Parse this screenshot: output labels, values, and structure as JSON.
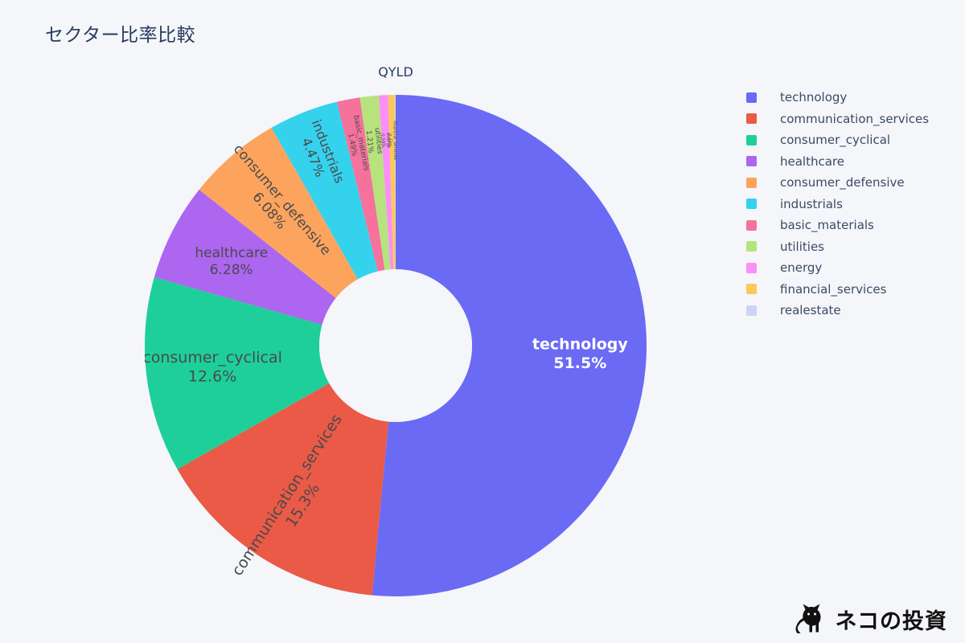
{
  "title": "セクター比率比較",
  "watermark": {
    "text": "ネコの投資",
    "icon": "cat-silhouette-icon"
  },
  "background_color": "#f4f6fa",
  "legend": {
    "position": "right",
    "items": [
      {
        "label": "technology",
        "color": "#6a6af4"
      },
      {
        "label": "communication_services",
        "color": "#ea5a47"
      },
      {
        "label": "consumer_cyclical",
        "color": "#1ecf9a"
      },
      {
        "label": "healthcare",
        "color": "#ac66f0"
      },
      {
        "label": "consumer_defensive",
        "color": "#fca45e"
      },
      {
        "label": "industrials",
        "color": "#35d2ee"
      },
      {
        "label": "basic_materials",
        "color": "#f4729b"
      },
      {
        "label": "utilities",
        "color": "#b7e37f"
      },
      {
        "label": "energy",
        "color": "#fb8ff6"
      },
      {
        "label": "financial_services",
        "color": "#fbc95b"
      },
      {
        "label": "realestate",
        "color": "#ccd4f5"
      }
    ]
  },
  "chart_data": {
    "type": "pie",
    "variant": "donut",
    "title": "セクター比率比較",
    "subtitle": "QYLD",
    "hole": 0.305,
    "start_angle_deg": 0,
    "direction": "clockwise",
    "units": "percent",
    "labels": [
      "technology",
      "communication_services",
      "consumer_cyclical",
      "healthcare",
      "consumer_defensive",
      "industrials",
      "basic_materials",
      "utilities",
      "energy",
      "financial_services",
      "realestate"
    ],
    "values": [
      51.5,
      15.3,
      12.6,
      6.28,
      6.08,
      4.47,
      1.49,
      1.21,
      0.59,
      0.44,
      0.04
    ],
    "colors": [
      "#6a6af4",
      "#ea5a47",
      "#1ecf9a",
      "#ac66f0",
      "#fca45e",
      "#35d2ee",
      "#f4729b",
      "#b7e37f",
      "#fb8ff6",
      "#fbc95b",
      "#ccd4f5"
    ],
    "slices": [
      {
        "label": "technology",
        "value": 51.5,
        "display": "51.5%",
        "color": "#6a6af4",
        "label_visible": true,
        "label_inverse": true
      },
      {
        "label": "communication_services",
        "value": 15.3,
        "display": "15.3%",
        "color": "#ea5a47",
        "label_visible": true,
        "label_inverse": false
      },
      {
        "label": "consumer_cyclical",
        "value": 12.6,
        "display": "12.6%",
        "color": "#1ecf9a",
        "label_visible": true,
        "label_inverse": false
      },
      {
        "label": "healthcare",
        "value": 6.28,
        "display": "6.28%",
        "color": "#ac66f0",
        "label_visible": true,
        "label_inverse": false
      },
      {
        "label": "consumer_defensive",
        "value": 6.08,
        "display": "6.08%",
        "color": "#fca45e",
        "label_visible": true,
        "label_inverse": false
      },
      {
        "label": "industrials",
        "value": 4.47,
        "display": "4.47%",
        "color": "#35d2ee",
        "label_visible": true,
        "label_inverse": false
      },
      {
        "label": "basic_materials",
        "value": 1.49,
        "display": "1.49%",
        "color": "#f4729b",
        "label_visible": true,
        "label_inverse": false
      },
      {
        "label": "utilities",
        "value": 1.21,
        "display": "1.21%",
        "color": "#b7e37f",
        "label_visible": true,
        "label_inverse": false
      },
      {
        "label": "energy",
        "value": 0.59,
        "display": "0.59%",
        "color": "#fb8ff6",
        "label_visible": true,
        "label_inverse": false
      },
      {
        "label": "financial_services",
        "value": 0.44,
        "display": "0.44%",
        "color": "#fbc95b",
        "label_visible": true,
        "label_inverse": false
      },
      {
        "label": "realestate",
        "value": 0.04,
        "display": "0.04%",
        "color": "#ccd4f5",
        "label_visible": false,
        "label_inverse": false
      }
    ]
  }
}
